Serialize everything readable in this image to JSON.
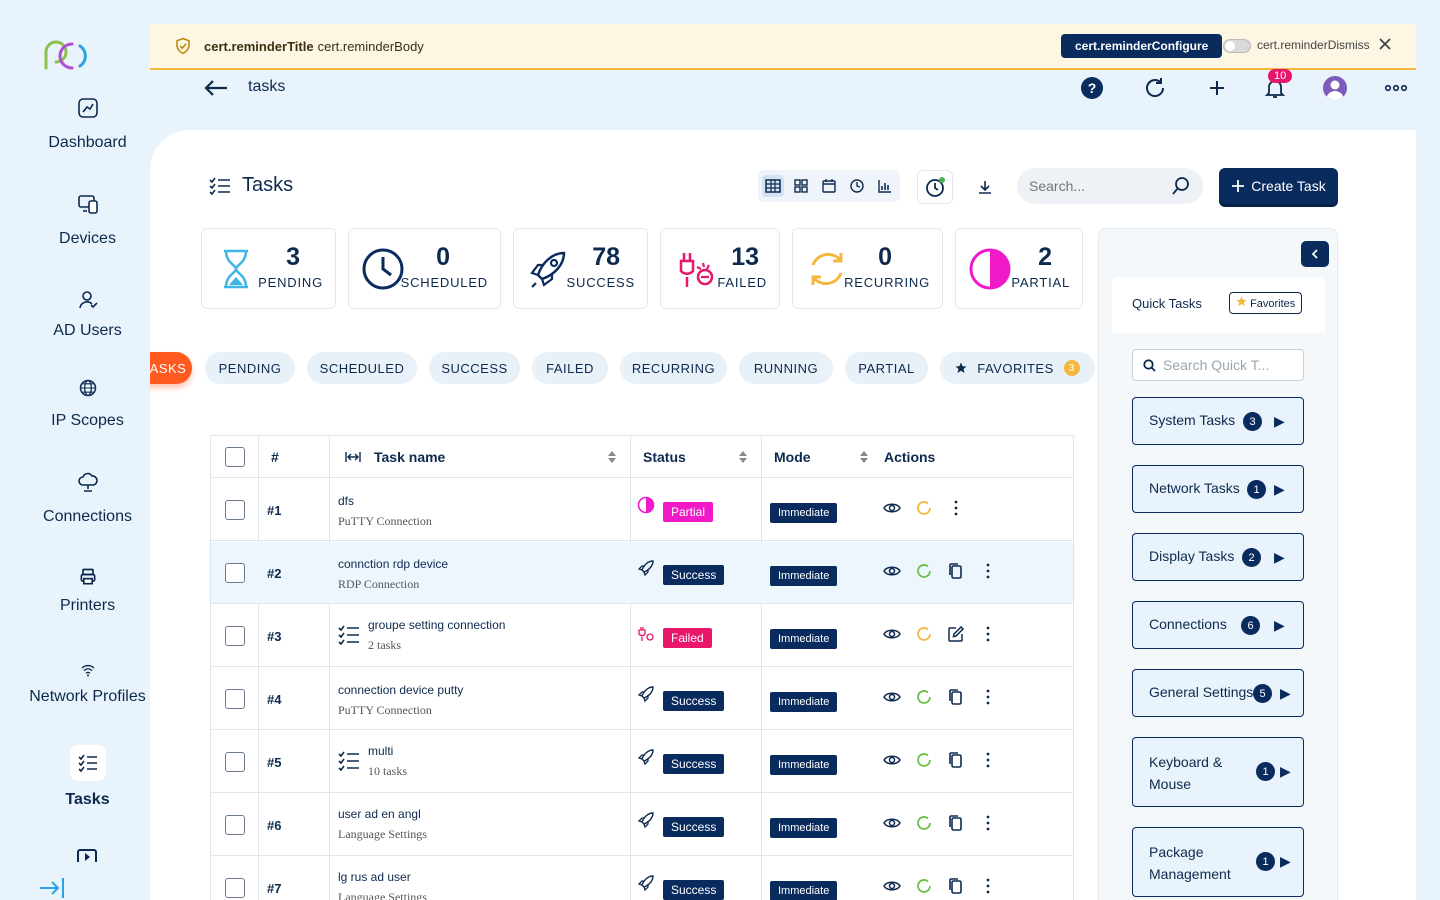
{
  "sidebar": {
    "items": [
      {
        "label": "Dashboard",
        "icon": "dashboard-icon"
      },
      {
        "label": "Devices",
        "icon": "devices-icon"
      },
      {
        "label": "AD Users",
        "icon": "ad-users-icon"
      },
      {
        "label": "IP Scopes",
        "icon": "globe-icon"
      },
      {
        "label": "Connections",
        "icon": "cloud-icon"
      },
      {
        "label": "Printers",
        "icon": "printer-icon"
      },
      {
        "label": "Network Profiles",
        "icon": "wifi-icon"
      },
      {
        "label": "Tasks",
        "icon": "tasks-icon"
      }
    ]
  },
  "banner": {
    "title": "cert.reminderTitle",
    "body": "cert.reminderBody",
    "configure": "cert.reminderConfigure",
    "dismiss": "cert.reminderDismiss"
  },
  "topbar": {
    "breadcrumb": "tasks",
    "notification_count": "10"
  },
  "page": {
    "title": "Tasks",
    "search_placeholder": "Search...",
    "create_label": "Create Task"
  },
  "stats": [
    {
      "value": "3",
      "label": "PENDING"
    },
    {
      "value": "0",
      "label": "SCHEDULED"
    },
    {
      "value": "78",
      "label": "SUCCESS"
    },
    {
      "value": "13",
      "label": "FAILED"
    },
    {
      "value": "0",
      "label": "RECURRING"
    },
    {
      "value": "2",
      "label": "PARTIAL"
    }
  ],
  "filters": {
    "all_label": "ASKS",
    "items": [
      "PENDING",
      "SCHEDULED",
      "SUCCESS",
      "FAILED",
      "RECURRING",
      "RUNNING",
      "PARTIAL"
    ],
    "favorites_label": "FAVORITES",
    "favorites_count": "3"
  },
  "table": {
    "headers": {
      "index": "#",
      "name": "Task name",
      "status": "Status",
      "mode": "Mode",
      "actions": "Actions"
    },
    "rows": [
      {
        "index": "#1",
        "name": "dfs",
        "sub": "PuTTY Connection",
        "status": "Partial",
        "mode": "Immediate"
      },
      {
        "index": "#2",
        "name": "connction rdp device",
        "sub": "RDP Connection",
        "status": "Success",
        "mode": "Immediate"
      },
      {
        "index": "#3",
        "name": "groupe setting connection",
        "sub": "2 tasks",
        "status": "Failed",
        "mode": "Immediate"
      },
      {
        "index": "#4",
        "name": "connection device putty",
        "sub": "PuTTY Connection",
        "status": "Success",
        "mode": "Immediate"
      },
      {
        "index": "#5",
        "name": "multi",
        "sub": "10 tasks",
        "status": "Success",
        "mode": "Immediate"
      },
      {
        "index": "#6",
        "name": "user ad en angl",
        "sub": "Language Settings",
        "status": "Success",
        "mode": "Immediate"
      },
      {
        "index": "#7",
        "name": "lg rus ad user",
        "sub": "Language Settings",
        "status": "Success",
        "mode": "Immediate"
      }
    ]
  },
  "quick_tasks": {
    "title": "Quick Tasks",
    "favorites_label": "Favorites",
    "search_placeholder": "Search Quick T...",
    "items": [
      {
        "label": "System Tasks",
        "count": "3"
      },
      {
        "label": "Network Tasks",
        "count": "1"
      },
      {
        "label": "Display Tasks",
        "count": "2"
      },
      {
        "label": "Connections",
        "count": "6"
      },
      {
        "label": "General Settings",
        "count": "5"
      },
      {
        "label": "Keyboard & Mouse",
        "count": "1"
      },
      {
        "label": "Package Management",
        "count": "1"
      }
    ]
  },
  "colors": {
    "navy": "#0a2b5e",
    "accent_orange": "#ff5a1f",
    "partial_magenta": "#f01ac8",
    "failed_pink": "#e8176b",
    "warning_amber": "#f4b740"
  }
}
